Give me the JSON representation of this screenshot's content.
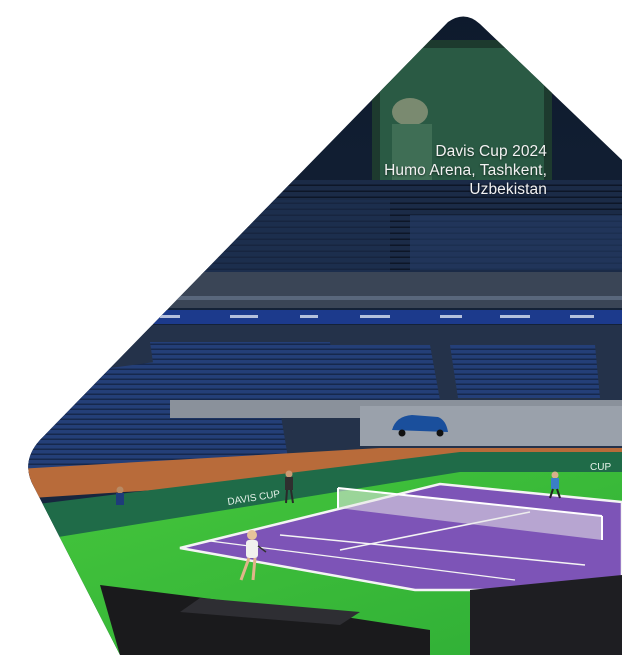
{
  "caption": {
    "line1": "Davis Cup 2024",
    "line2": "Humo Arena, Tashkent,",
    "line3": "Uzbekistan"
  },
  "court_banner": {
    "text_left": "DAVIS CUP",
    "text_right": "CUP"
  },
  "colors": {
    "court_purple": "#7d54b7",
    "court_surround": "#3bbf3b",
    "seats_blue": "#21386a",
    "barrier_green": "#1f6b48"
  }
}
